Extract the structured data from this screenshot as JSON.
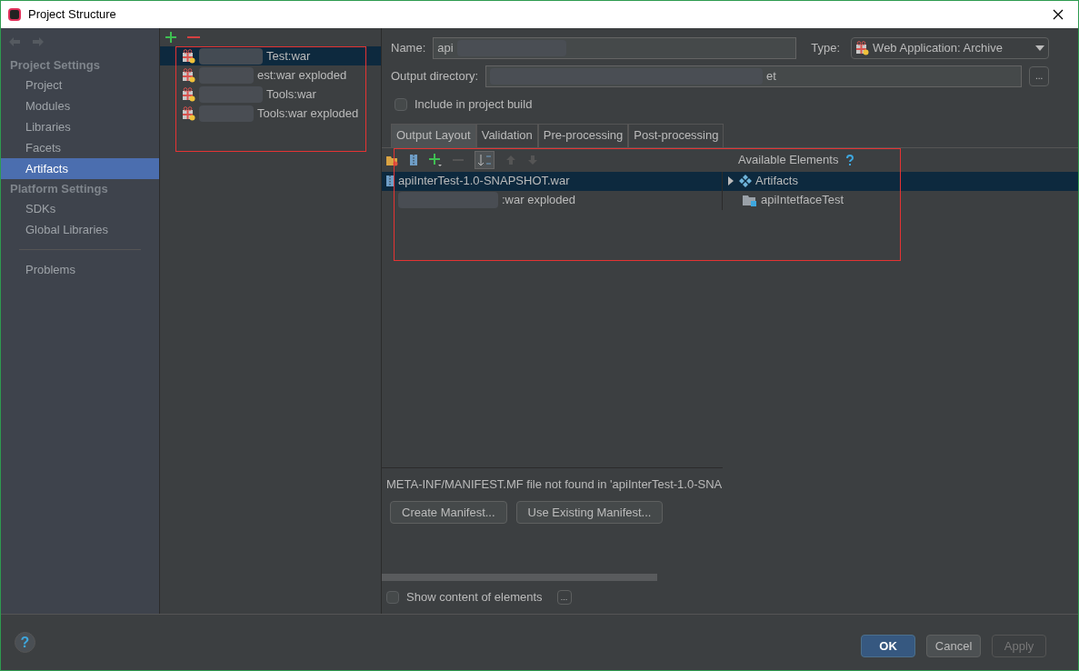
{
  "window": {
    "title": "Project Structure"
  },
  "sidebar": {
    "sections": [
      {
        "heading": "Project Settings",
        "items": [
          {
            "label": "Project",
            "selected": false
          },
          {
            "label": "Modules",
            "selected": false
          },
          {
            "label": "Libraries",
            "selected": false
          },
          {
            "label": "Facets",
            "selected": false
          },
          {
            "label": "Artifacts",
            "selected": true
          }
        ]
      },
      {
        "heading": "Platform Settings",
        "items": [
          {
            "label": "SDKs",
            "selected": false
          },
          {
            "label": "Global Libraries",
            "selected": false
          }
        ]
      }
    ],
    "footer_items": [
      {
        "label": "Problems",
        "selected": false
      }
    ]
  },
  "artifacts": [
    {
      "label": "Test:war",
      "selected": true
    },
    {
      "label": "est:war exploded",
      "selected": false
    },
    {
      "label": "Tools:war",
      "selected": false
    },
    {
      "label": "Tools:war exploded",
      "selected": false
    }
  ],
  "form": {
    "name_label": "Name:",
    "name_value": "api",
    "type_label": "Type:",
    "type_value": "Web Application: Archive",
    "output_label": "Output directory:",
    "output_value": "et",
    "browse_label": "...",
    "include_label": "Include in project build",
    "include_checked": false
  },
  "tabs": [
    {
      "label": "Output Layout",
      "selected": true
    },
    {
      "label": "Validation",
      "selected": false
    },
    {
      "label": "Pre-processing",
      "selected": false
    },
    {
      "label": "Post-processing",
      "selected": false
    }
  ],
  "layout_tree": [
    {
      "label": "apiInterTest-1.0-SNAPSHOT.war",
      "kind": "archive",
      "selected": true
    },
    {
      "label": ":war exploded",
      "kind": "exploded",
      "selected": false
    }
  ],
  "available": {
    "title": "Available Elements",
    "items": [
      {
        "label": "Artifacts",
        "kind": "group",
        "expanded": false,
        "selected": true
      },
      {
        "label": "apiIntetfaceTest",
        "kind": "module",
        "selected": false
      }
    ]
  },
  "manifest_message": "META-INF/MANIFEST.MF file not found in 'apiInterTest-1.0-SNA",
  "manifest_buttons": [
    "Create Manifest...",
    "Use Existing Manifest..."
  ],
  "show_content": {
    "label": "Show content of elements",
    "checked": false,
    "more_label": "..."
  },
  "help_label": "?",
  "buttons": [
    {
      "label": "OK",
      "kind": "default"
    },
    {
      "label": "Cancel",
      "kind": "normal"
    },
    {
      "label": "Apply",
      "kind": "disabled"
    }
  ]
}
